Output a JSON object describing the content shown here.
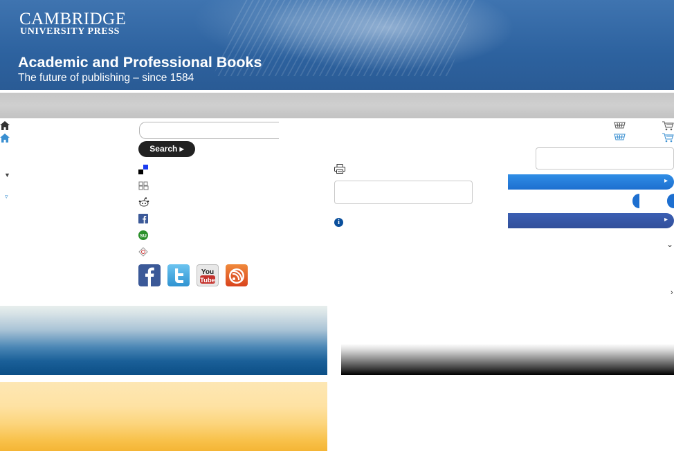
{
  "header": {
    "logo_line1": "CAMBRIDGE",
    "logo_line2": "UNIVERSITY PRESS",
    "title": "Academic and Professional Books",
    "tagline": "The future of publishing – since 1584"
  },
  "search": {
    "placeholder": "",
    "button_label": "Search ▸"
  },
  "icons": {
    "home": "home-icon",
    "basket": "basket-icon",
    "cart": "cart-icon",
    "print": "print-icon",
    "info": "info-icon",
    "info_glyph": "i"
  },
  "share_services": [
    "delicious-icon",
    "digg-icon",
    "reddit-icon",
    "facebook-icon",
    "stumbleupon-icon",
    "technorati-icon"
  ],
  "social": [
    {
      "name": "facebook-button",
      "glyph": "f",
      "color": "#3b5998"
    },
    {
      "name": "twitter-button",
      "glyph": "t",
      "color": "#55acee"
    },
    {
      "name": "youtube-button",
      "glyph": "You Tube",
      "color": "#c4302b"
    },
    {
      "name": "blog-rss-button",
      "glyph": "b",
      "color": "#e55a2b"
    }
  ],
  "colors": {
    "header": "#2d629f",
    "nav": "#c9c9c9",
    "accent_blue": "#1d6fd0",
    "facebook_blue": "#3b5998"
  },
  "arrows": {
    "bar": "▸",
    "collapse": "▼",
    "collapse_small": "▿",
    "chevron_down": "⌄",
    "chevron_right": "›"
  }
}
